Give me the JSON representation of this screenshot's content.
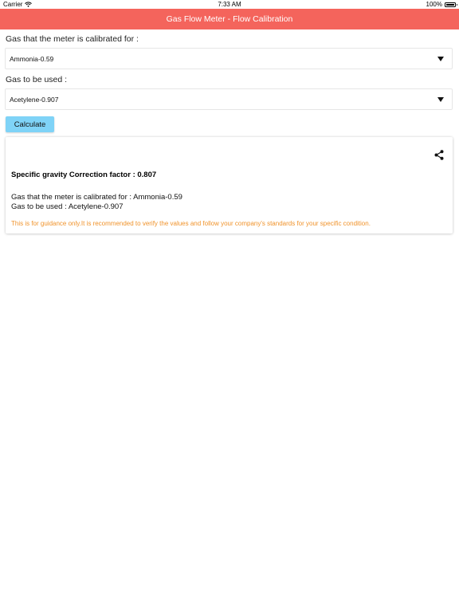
{
  "status_bar": {
    "carrier": "Carrier",
    "time": "7:33 AM",
    "battery": "100%",
    "battery_level": 1.0
  },
  "header": {
    "title": "Gas Flow Meter - Flow Calibration"
  },
  "form": {
    "calibrated_label": "Gas that the meter is calibrated for :",
    "calibrated_value": "Ammonia-0.59",
    "used_label": "Gas to be used :",
    "used_value": "Acetylene-0.907",
    "calculate_label": "Calculate"
  },
  "result": {
    "factor_text": "Specific gravity Correction factor : 0.807",
    "calibrated_text": "Gas that the meter is calibrated for : Ammonia-0.59",
    "used_text": "Gas to be used : Acetylene-0.907",
    "disclaimer": "This is for guidance only.It is recommended to verify the values and follow your company's standards for your specific condition."
  },
  "colors": {
    "header_bg": "#f4645c",
    "button_bg": "#7fd3f7",
    "disclaimer_text": "#f0932b"
  },
  "icons": {
    "wifi": "wifi-icon",
    "battery": "battery-icon",
    "dropdown": "caret-down-icon",
    "share": "share-icon"
  }
}
